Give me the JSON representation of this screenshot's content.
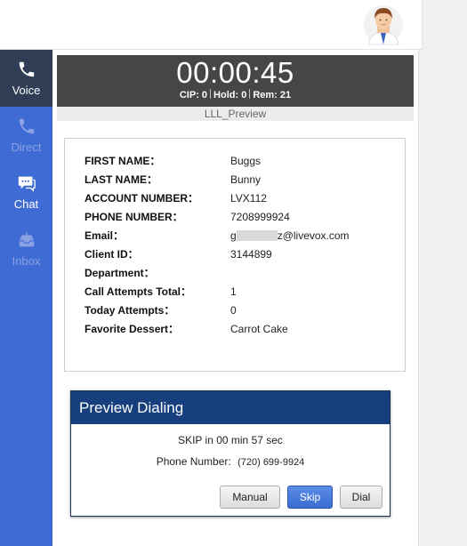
{
  "sidebar": {
    "items": [
      {
        "label": "Voice",
        "icon": "phone-icon",
        "state": "active"
      },
      {
        "label": "Direct",
        "icon": "phone-direct-icon",
        "state": "disabled"
      },
      {
        "label": "Chat",
        "icon": "chat-icon",
        "state": "enabled"
      },
      {
        "label": "Inbox",
        "icon": "inbox-icon",
        "state": "disabled"
      }
    ]
  },
  "timer": {
    "value": "00:00:45",
    "cip": "CIP: 0",
    "hold": "Hold: 0",
    "rem": "Rem: 21"
  },
  "campaign": "LLL_Preview",
  "contact": {
    "fields": [
      {
        "label": "FIRST NAME：",
        "value": "Buggs"
      },
      {
        "label": "LAST NAME：",
        "value": "Bunny"
      },
      {
        "label": "ACCOUNT NUMBER：",
        "value": "LVX112"
      },
      {
        "label": "PHONE NUMBER：",
        "value": "7208999924"
      },
      {
        "label": "Email：",
        "value_prefix": "g",
        "value_suffix": "z@livevox.com"
      },
      {
        "label": "Client ID：",
        "value": "3144899"
      },
      {
        "label": "Department：",
        "value": ""
      },
      {
        "label": "Call Attempts Total：",
        "value": "1"
      },
      {
        "label": "Today Attempts：",
        "value": "0"
      },
      {
        "label": "Favorite Dessert：",
        "value": "Carrot Cake"
      }
    ]
  },
  "dialog": {
    "title": "Preview Dialing",
    "skip_text": "SKIP in 00 min 57 sec",
    "phone_label": "Phone Number:",
    "phone_value": "(720) 699-9924",
    "buttons": {
      "manual": "Manual",
      "skip": "Skip",
      "dial": "Dial"
    }
  },
  "colors": {
    "sidebar": "#3f6bd4",
    "sidebar_active": "#2f3d55",
    "timer_bg": "#464646",
    "dialog_header": "#173f7e",
    "skip_button": "#3a6ed4"
  }
}
